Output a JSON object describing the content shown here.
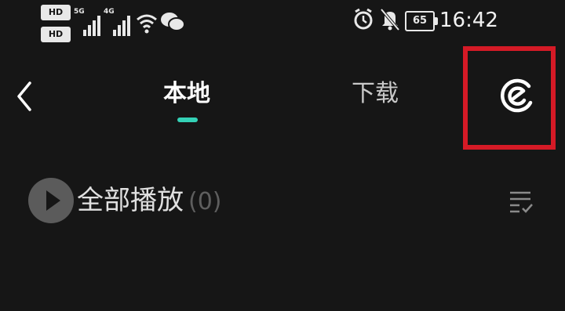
{
  "status_bar": {
    "hd_badges": [
      "HD",
      "HD"
    ],
    "signal_1_gen": "5G",
    "signal_2_gen": "4G",
    "battery": "65",
    "time": "16:42",
    "icons": [
      "wifi-icon",
      "wechat-icon",
      "alarm-icon",
      "mute-icon"
    ]
  },
  "nav": {
    "tabs": [
      {
        "label": "本地",
        "active": true
      },
      {
        "label": "下载",
        "active": false
      }
    ],
    "indicator_color": "#34d1b6",
    "back_icon": "chevron-left-icon",
    "recognize_icon": "music-recognition-icon",
    "highlight_color": "#d51a26"
  },
  "list": {
    "play_all_label": "全部播放",
    "play_all_count": "(0)",
    "manage_icon": "multi-select-icon"
  },
  "colors": {
    "background": "#161616"
  }
}
